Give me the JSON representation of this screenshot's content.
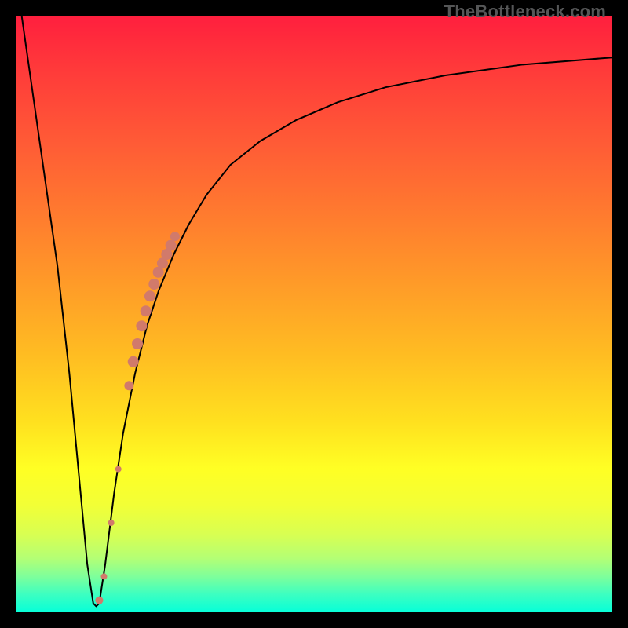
{
  "watermark": "TheBottleneck.com",
  "colors": {
    "background": "#000000",
    "curve": "#000000",
    "points": "#d17a6b",
    "gradient_top": "#ff1f3e",
    "gradient_bottom": "#06ffd8"
  },
  "chart_data": {
    "type": "line",
    "title": "",
    "xlabel": "",
    "ylabel": "",
    "xlim": [
      0,
      100
    ],
    "ylim": [
      0,
      100
    ],
    "curve": {
      "x": [
        1,
        3,
        5,
        7,
        9,
        10.5,
        12,
        13,
        13.5,
        14,
        15,
        16.5,
        18,
        20,
        22,
        24,
        26.5,
        29,
        32,
        36,
        41,
        47,
        54,
        62,
        72,
        85,
        100
      ],
      "y": [
        100,
        86,
        72,
        58,
        40,
        24,
        8,
        1.5,
        1,
        1.5,
        8,
        20,
        30,
        40,
        48,
        54,
        60,
        65,
        70,
        75,
        79,
        82.5,
        85.5,
        88,
        90,
        91.8,
        93
      ]
    },
    "series": [
      {
        "name": "points-stroke",
        "type": "scatter",
        "x": [
          14,
          14.8,
          16,
          17.2,
          19,
          19.7,
          20.4,
          21.1,
          21.8,
          22.5,
          23.2,
          23.9,
          24.6,
          25.3,
          26,
          26.7
        ],
        "y": [
          2,
          6,
          15,
          24,
          38,
          42,
          45,
          48,
          50.5,
          53,
          55,
          57,
          58.5,
          60,
          61.5,
          63
        ],
        "r": [
          5,
          4,
          4,
          4,
          6,
          7,
          7,
          7,
          7,
          7,
          7,
          7,
          7,
          7,
          7,
          6
        ]
      }
    ]
  }
}
